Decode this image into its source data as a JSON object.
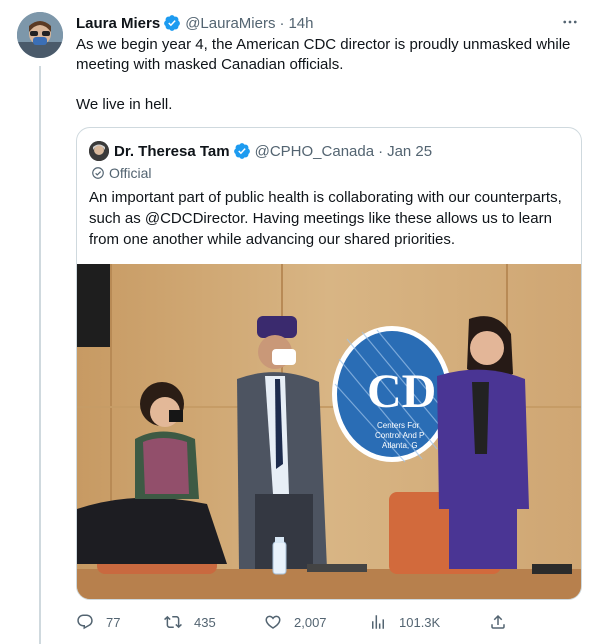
{
  "tweet": {
    "author_name": "Laura Miers",
    "author_handle": "@LauraMiers",
    "separator": "·",
    "time": "14h",
    "text": "As we begin year 4, the American CDC director is proudly unmasked while meeting with masked Canadian officials.\n\nWe live in hell."
  },
  "quoted_tweet": {
    "author_name": "Dr. Theresa Tam",
    "author_handle": "@CPHO_Canada",
    "separator": "·",
    "time": "Jan 25",
    "official_label": "Official",
    "text": "An important part of public health is collaborating with our counterparts, such as @CDCDirector. Having meetings like these allows us to learn from one another while advancing our shared priorities.",
    "photo": {
      "sign_text": "CDC",
      "sign_subtext_1": "Centers For",
      "sign_subtext_2": "Control And P",
      "sign_subtext_3": "Atlanta, G"
    }
  },
  "actions": {
    "replies": "77",
    "retweets": "435",
    "likes": "2,007",
    "views": "101.3K"
  },
  "colors": {
    "verified": "#1d9bf0",
    "secondary_text": "#536471",
    "border": "#cfd9de"
  }
}
